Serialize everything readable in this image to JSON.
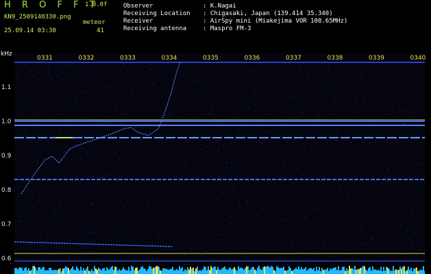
{
  "header": {
    "title": "H R O F F T",
    "version": "1.0.0f",
    "filename": "KN9_2509140330.png",
    "datetime": "25.09.14 03:30",
    "meteor_label": "meteor",
    "meteor_count": "41",
    "info_labels": [
      "Observer",
      "Receiving Location",
      "Receiver",
      "Receiving antenna"
    ],
    "info_values": [
      ": K.Nagai",
      ": Chigasaki, Japan (139.414 35.340)",
      ": AirSpy mini (Miakejima VOR 108.65MHz)",
      ": Maspro FM-3"
    ]
  },
  "axis": {
    "unit": "kHz",
    "y_ticks": [
      "1.1",
      "1.0",
      "0.9",
      "0.8",
      "0.7",
      "0.6"
    ],
    "x_ticks": [
      "0331",
      "0332",
      "0333",
      "0334",
      "0335",
      "0336",
      "0337",
      "0338",
      "0339",
      "0340"
    ]
  },
  "colors": {
    "background": "#000000",
    "signal": "#3a5cff",
    "marker": "#e8e24a"
  }
}
